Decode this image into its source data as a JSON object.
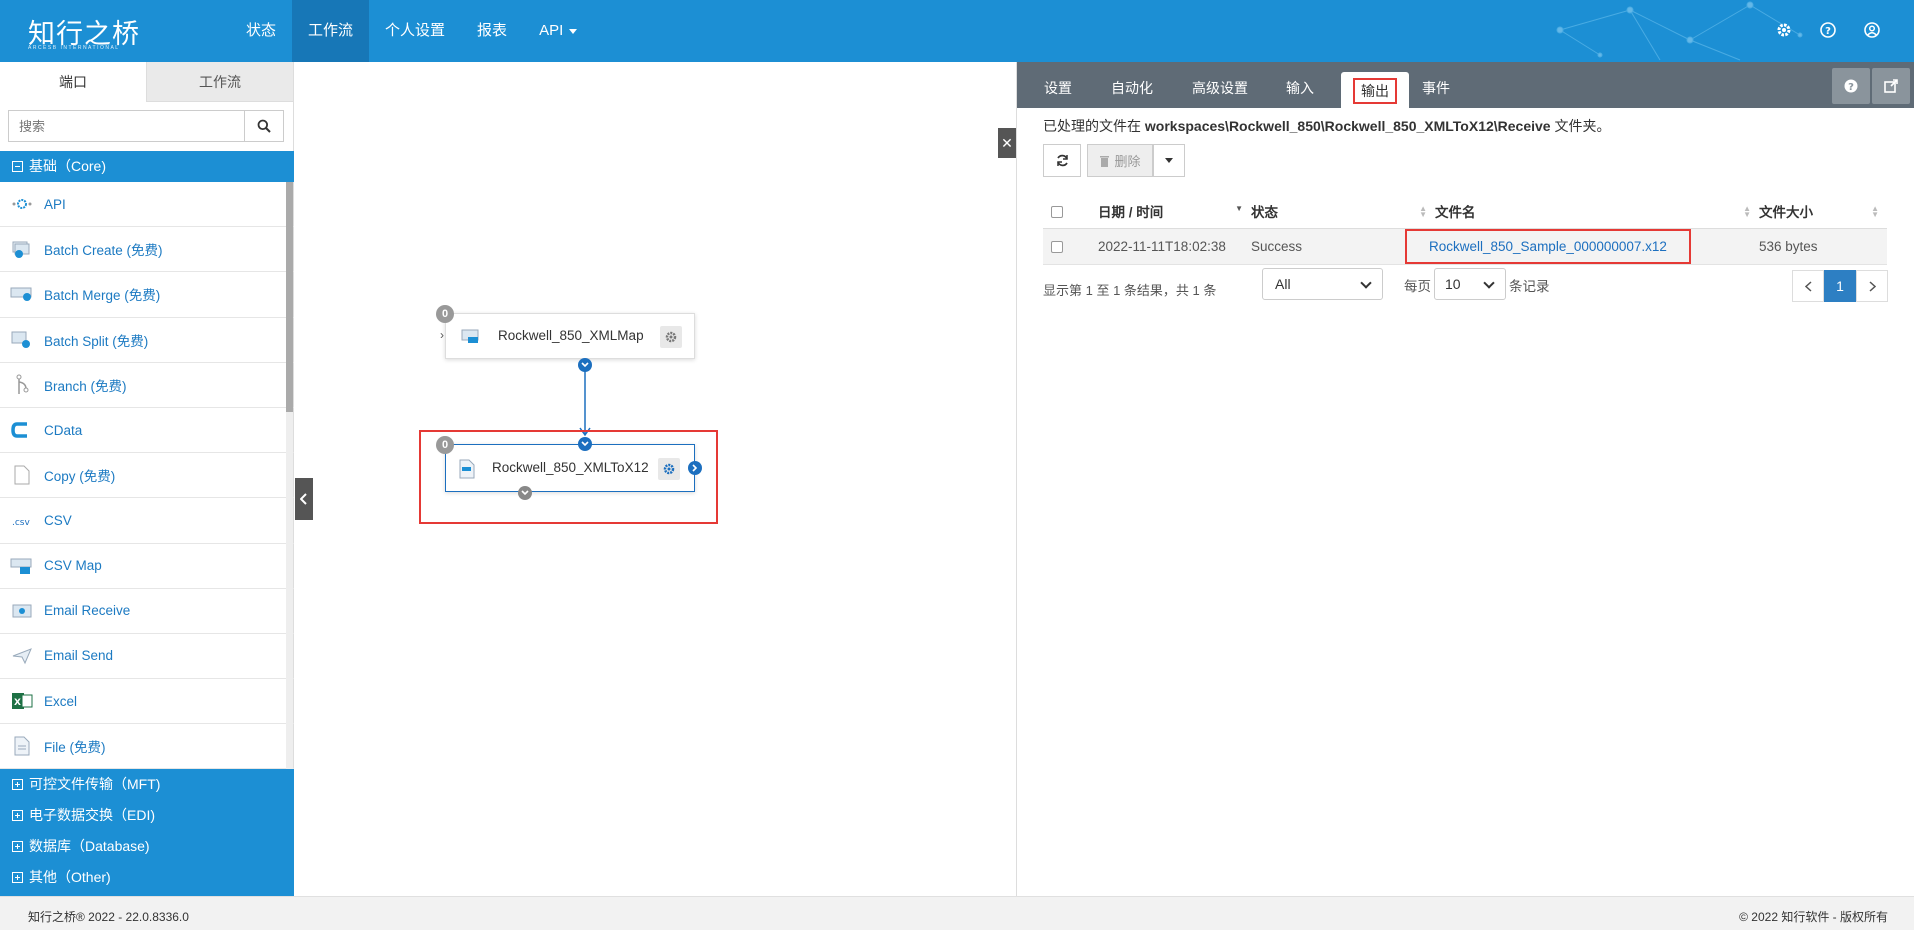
{
  "app": {
    "logo_text": "知行之桥",
    "logo_sub": "ARCESB INTERNATIONAL"
  },
  "nav": {
    "items": [
      {
        "label": "状态"
      },
      {
        "label": "工作流"
      },
      {
        "label": "个人设置"
      },
      {
        "label": "报表"
      },
      {
        "label": "API"
      }
    ]
  },
  "sidebar": {
    "tabs": [
      {
        "label": "端口"
      },
      {
        "label": "工作流"
      }
    ],
    "search": {
      "placeholder": "搜索",
      "value": ""
    },
    "groups": [
      {
        "label": "基础（Core)",
        "expanded": true
      },
      {
        "label": "可控文件传输（MFT)"
      },
      {
        "label": "电子数据交换（EDI)"
      },
      {
        "label": "数据库（Database)"
      },
      {
        "label": "其他（Other)"
      }
    ],
    "connectors": [
      {
        "label": "API",
        "icon": "api-icon"
      },
      {
        "label": "Batch Create (免费)",
        "icon": "batch-create-icon"
      },
      {
        "label": "Batch Merge (免费)",
        "icon": "batch-merge-icon"
      },
      {
        "label": "Batch Split (免费)",
        "icon": "batch-split-icon"
      },
      {
        "label": "Branch (免费)",
        "icon": "branch-icon"
      },
      {
        "label": "CData",
        "icon": "cdata-icon"
      },
      {
        "label": "Copy (免费)",
        "icon": "copy-icon"
      },
      {
        "label": "CSV",
        "icon": "csv-icon"
      },
      {
        "label": "CSV Map",
        "icon": "csv-map-icon"
      },
      {
        "label": "Email Receive",
        "icon": "email-receive-icon"
      },
      {
        "label": "Email Send",
        "icon": "email-send-icon"
      },
      {
        "label": "Excel",
        "icon": "excel-icon"
      },
      {
        "label": "File (免费)",
        "icon": "file-icon"
      }
    ]
  },
  "canvas": {
    "nodes": [
      {
        "name": "Rockwell_850_XMLMap",
        "count": "0"
      },
      {
        "name": "Rockwell_850_XMLToX12",
        "count": "0"
      }
    ]
  },
  "panel": {
    "tabs": [
      {
        "label": "设置"
      },
      {
        "label": "自动化"
      },
      {
        "label": "高级设置"
      },
      {
        "label": "输入"
      },
      {
        "label": "输出"
      },
      {
        "label": "事件"
      }
    ],
    "path_prefix": "已处理的文件在",
    "path": "workspaces\\Rockwell_850\\Rockwell_850_XMLToX12\\Receive",
    "path_suffix": "文件夹。",
    "delete_label": "删除",
    "columns": [
      "日期 / 时间",
      "状态",
      "文件名",
      "文件大小"
    ],
    "rows": [
      {
        "datetime": "2022-11-11T18:02:38",
        "status": "Success",
        "filename": "Rockwell_850_Sample_000000007.x12",
        "size": "536 bytes"
      }
    ],
    "summary": "显示第 1 至 1 条结果，共 1 条",
    "filter_value": "All",
    "per_page_label": "每页",
    "per_page_value": "10",
    "records_label": "条记录",
    "current_page": "1"
  },
  "footer": {
    "left": "知行之桥® 2022 - 22.0.8336.0",
    "right": "© 2022 知行软件 - 版权所有"
  },
  "colors": {
    "brand": "#1c8fd4",
    "highlight": "#e53935",
    "success": "#2e8b57",
    "link": "#1c6fbf"
  }
}
